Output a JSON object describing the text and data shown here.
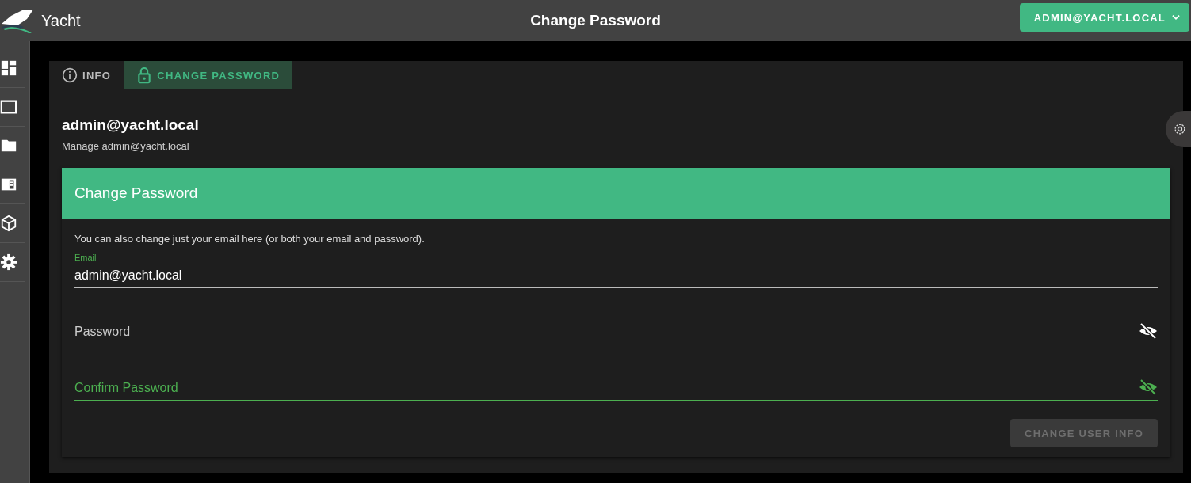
{
  "app": {
    "name": "Yacht"
  },
  "header": {
    "title": "Change Password",
    "user_button": "ADMIN@YACHT.LOCAL"
  },
  "sidebar": {
    "items": [
      {
        "kind": "dashboard"
      },
      {
        "kind": "window"
      },
      {
        "kind": "folder"
      },
      {
        "kind": "list"
      },
      {
        "kind": "cube"
      },
      {
        "kind": "gear"
      }
    ]
  },
  "tabs": [
    {
      "label": "INFO",
      "kind": "info",
      "selected": false
    },
    {
      "label": "CHANGE PASSWORD",
      "kind": "lock",
      "selected": true
    }
  ],
  "user": {
    "name": "admin@yacht.local",
    "subtitle": "Manage admin@yacht.local"
  },
  "form": {
    "title": "Change Password",
    "note": "You can also change just your email here (or both your email and password).",
    "fields": [
      {
        "label": "Email",
        "value": "admin@yacht.local",
        "focused": false,
        "kind": "text"
      },
      {
        "placeholder": "Password",
        "focused": false,
        "kind": "password"
      },
      {
        "placeholder": "Confirm Password",
        "focused": true,
        "kind": "password"
      }
    ],
    "submit": {
      "label": "CHANGE USER INFO",
      "disabled": true
    }
  }
}
